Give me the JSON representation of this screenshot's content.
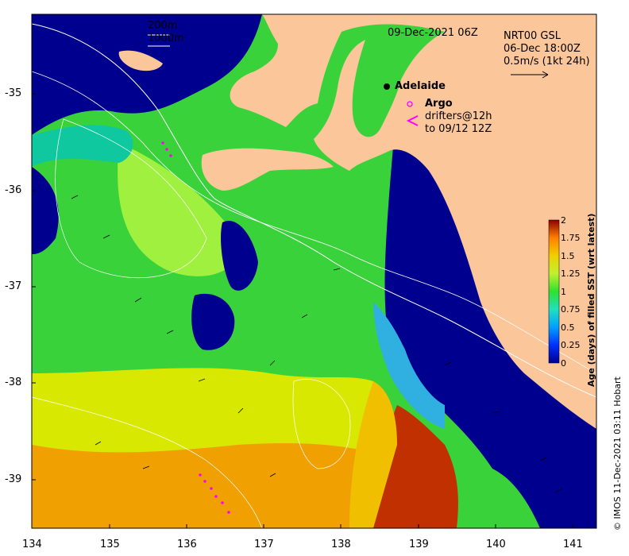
{
  "map": {
    "date_label": "09-Dec-2021 06Z",
    "legend": {
      "contour_200": "200m",
      "contour_1000": "1000m",
      "product": "NRT00 GSL",
      "product_time": "06-Dec 18:00Z",
      "velocity_scale": "0.5m/s (1kt 24h)",
      "city": "Adelaide",
      "argo": "Argo",
      "drifters_line1": "drifters@12h",
      "drifters_line2": "to 09/12 12Z"
    },
    "x_ticks": [
      "134",
      "135",
      "136",
      "137",
      "138",
      "139",
      "140",
      "141"
    ],
    "y_ticks": [
      "-35",
      "-36",
      "-37",
      "-38",
      "-39"
    ],
    "colorbar": {
      "title": "Age (days) of filled SST (wrt latest)",
      "ticks": [
        "2",
        "1.75",
        "1.5",
        "1.25",
        "1",
        "0.75",
        "0.5",
        "0.25",
        "0"
      ],
      "range": [
        0,
        2
      ]
    },
    "credit": "© IMOS 11-Dec-2021 03:11 Hobart",
    "colors": {
      "land": "#fbc69a",
      "deep_blue": "#00008f",
      "green": "#3ce63c",
      "yellow": "#e6e600",
      "orange": "#ff9f00",
      "red": "#b21a00"
    }
  }
}
